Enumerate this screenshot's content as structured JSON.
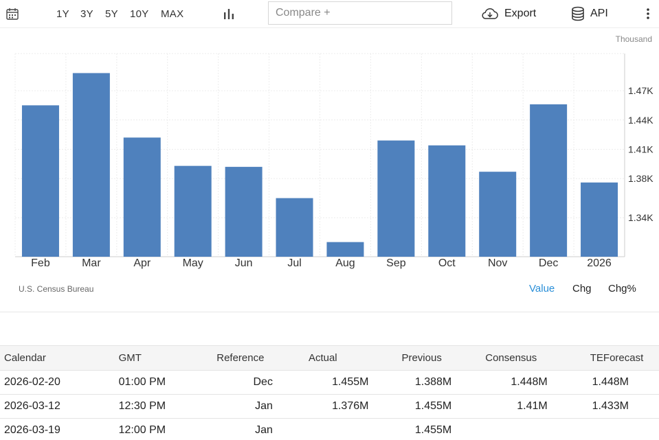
{
  "toolbar": {
    "ranges": [
      "1Y",
      "3Y",
      "5Y",
      "10Y",
      "MAX"
    ],
    "compare_placeholder": "Compare +",
    "export_label": "Export",
    "api_label": "API"
  },
  "chart": {
    "unit": "Thousand",
    "source": "U.S. Census Bureau",
    "modes": [
      "Value",
      "Chg",
      "Chg%"
    ],
    "active_mode": "Value",
    "bar_color": "#4f81bd"
  },
  "chart_data": {
    "type": "bar",
    "categories": [
      "Feb",
      "Mar",
      "Apr",
      "May",
      "Jun",
      "Jul",
      "Aug",
      "Sep",
      "Oct",
      "Nov",
      "Dec",
      "2026"
    ],
    "values": [
      1455,
      1488,
      1422,
      1393,
      1392,
      1360,
      1315,
      1419,
      1414,
      1387,
      1456,
      1376
    ],
    "y_ticks": [
      1340,
      1380,
      1410,
      1440,
      1470
    ],
    "y_tick_labels": [
      "1.34K",
      "1.38K",
      "1.41K",
      "1.44K",
      "1.47K"
    ],
    "ylim": [
      1300,
      1508
    ],
    "ylabel": "Thousand",
    "grid": true,
    "axis_position": "right"
  },
  "calendar": {
    "columns": [
      "Calendar",
      "GMT",
      "Reference",
      "Actual",
      "Previous",
      "Consensus",
      "TEForecast"
    ],
    "rows": [
      [
        "2026-02-20",
        "01:00 PM",
        "Dec",
        "1.455M",
        "1.388M",
        "1.448M",
        "1.448M"
      ],
      [
        "2026-03-12",
        "12:30 PM",
        "Jan",
        "1.376M",
        "1.455M",
        "1.41M",
        "1.433M"
      ],
      [
        "2026-03-19",
        "12:00 PM",
        "Jan",
        "",
        "1.455M",
        "",
        ""
      ]
    ]
  }
}
